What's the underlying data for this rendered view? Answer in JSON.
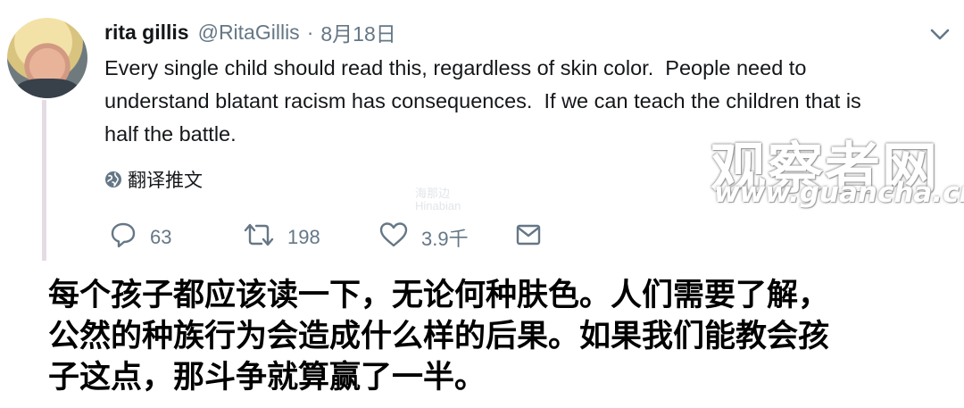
{
  "tweet": {
    "name": "rita gillis",
    "handle": "@RitaGillis",
    "separator": "·",
    "date": "8月18日",
    "text_lines": [
      "Every single child should read this, regardless of skin color.  People need to",
      "understand blatant racism has consequences.  If we can teach the children that is",
      "half the battle."
    ],
    "translate_label": "翻译推文",
    "actions": {
      "reply_count": "63",
      "retweet_count": "198",
      "like_count": "3.9千"
    },
    "icons": [
      "avatar",
      "chevron-down-icon",
      "globe-icon",
      "reply-icon",
      "retweet-icon",
      "heart-icon",
      "message-icon"
    ]
  },
  "watermark": {
    "site_cn": "观察者网",
    "site_url": "www.guancha.cn",
    "small_mark_line1": "海那边",
    "small_mark_line2": "Hinabian"
  },
  "caption_lines": [
    "每个孩子都应该读一下，无论何种肤色。人们需要了解，",
    "公然的种族行为会造成什么样的后果。如果我们能教会孩",
    "子这点，那斗争就算赢了一半。"
  ],
  "colors": {
    "text": "#14171a",
    "muted": "#657786",
    "thread_line": "#e5dbe3"
  }
}
